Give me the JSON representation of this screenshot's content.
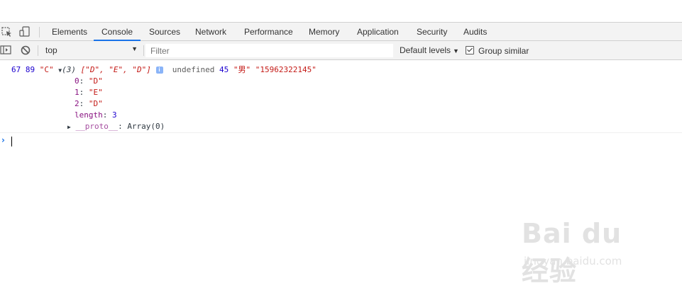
{
  "tabs": [
    {
      "label": "Elements"
    },
    {
      "label": "Console"
    },
    {
      "label": "Sources"
    },
    {
      "label": "Network"
    },
    {
      "label": "Performance"
    },
    {
      "label": "Memory"
    },
    {
      "label": "Application"
    },
    {
      "label": "Security"
    },
    {
      "label": "Audits"
    }
  ],
  "active_tab": "Console",
  "toolbar": {
    "context": "top",
    "filter_placeholder": "Filter",
    "levels_label": "Default levels",
    "group_similar_label": "Group similar",
    "group_similar_checked": true
  },
  "console": {
    "log": {
      "v1": "67",
      "v2": "89",
      "v3": "\"C\"",
      "array_preview_count": "(3)",
      "array_preview": "[\"D\", \"E\", \"D\"]",
      "v5": "undefined",
      "v6": "45",
      "v7": "\"男\"",
      "v8": "\"15962322145\"",
      "entries": [
        {
          "key": "0",
          "value": "\"D\""
        },
        {
          "key": "1",
          "value": "\"E\""
        },
        {
          "key": "2",
          "value": "\"D\""
        }
      ],
      "length_key": "length",
      "length_value": "3",
      "proto_key": "__proto__",
      "proto_value": "Array(0)"
    }
  },
  "watermark": {
    "main": "Bai du 经验",
    "sub": "jingyan.baidu.com"
  },
  "colors": {
    "accent": "#1a73e8",
    "number": "#1c00cf",
    "string": "#c41a16",
    "property": "#881280"
  }
}
